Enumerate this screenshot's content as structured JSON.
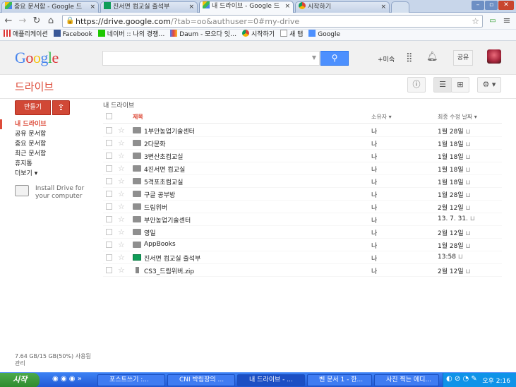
{
  "browser": {
    "tabs": [
      {
        "label": "중요 문서함 - Google 드",
        "active": false
      },
      {
        "label": "진서면 컴교실 출석부",
        "active": false
      },
      {
        "label": "내 드라이브 - Google 드",
        "active": true
      },
      {
        "label": "시작하기",
        "active": false
      }
    ],
    "url_host": "https://drive.google.com",
    "url_path": "/?tab=oo&authuser=0#my-drive",
    "bookmarks": [
      "애플리케이션",
      "Facebook",
      "네이버 :: 나의 경쟁…",
      "Daum - 모으다 잇…",
      "시작하기",
      "새 탭",
      "Google"
    ]
  },
  "gbar": {
    "logo": "Google",
    "plus_label": "+미숙",
    "share_label": "공유"
  },
  "drive": {
    "title": "드라이브",
    "create_label": "만들기",
    "nav": [
      "내 드라이브",
      "공유 문서함",
      "중요 문서함",
      "최근 문서함",
      "휴지통",
      "더보기 ▾"
    ],
    "install_text": "Install Drive for your computer",
    "storage": "7.64 GB/15 GB(50%) 사용됨",
    "storage_manage": "관리",
    "breadcrumb": "내 드라이브",
    "columns": {
      "title": "제목",
      "owner": "소유자",
      "modified": "최종 수정 날짜"
    },
    "files": [
      {
        "name": "1부안농업기술센터",
        "type": "folder",
        "owner": "나",
        "modified": "1월 28일"
      },
      {
        "name": "2다문화",
        "type": "folder",
        "owner": "나",
        "modified": "1월 18일"
      },
      {
        "name": "3변산초컴교실",
        "type": "folder",
        "owner": "나",
        "modified": "1월 18일"
      },
      {
        "name": "4진서면 컴교실",
        "type": "folder",
        "owner": "나",
        "modified": "1월 18일"
      },
      {
        "name": "5격포초컴교실",
        "type": "folder",
        "owner": "나",
        "modified": "1월 18일"
      },
      {
        "name": "구글 공부방",
        "type": "folder",
        "owner": "나",
        "modified": "1월 28일"
      },
      {
        "name": "드림위버",
        "type": "folder",
        "owner": "나",
        "modified": "2월 12일"
      },
      {
        "name": "부안농업기술센터",
        "type": "folder",
        "owner": "나",
        "modified": "13. 7. 31."
      },
      {
        "name": "영일",
        "type": "folder",
        "owner": "나",
        "modified": "2월 12일"
      },
      {
        "name": "AppBooks",
        "type": "folder",
        "owner": "나",
        "modified": "1월 28일"
      },
      {
        "name": "진서면 컴교실 출석부",
        "type": "sheet",
        "owner": "나",
        "modified": "13:58"
      },
      {
        "name": "CS3_드림위버.zip",
        "type": "zip",
        "owner": "나",
        "modified": "2월 12일"
      }
    ]
  },
  "taskbar": {
    "start": "시작",
    "tasks": [
      "포스트쓰기 :...",
      "CNI 박림장의 ...",
      "내 드라이브 - ...",
      "벤 문서 1 - 한...",
      "사진 찍는 에디..."
    ],
    "clock": "오후 2:16"
  },
  "colors": {
    "accent_red": "#dd4b39",
    "google_blue": "#4d90fe",
    "taskbar_blue": "#2259d6"
  }
}
